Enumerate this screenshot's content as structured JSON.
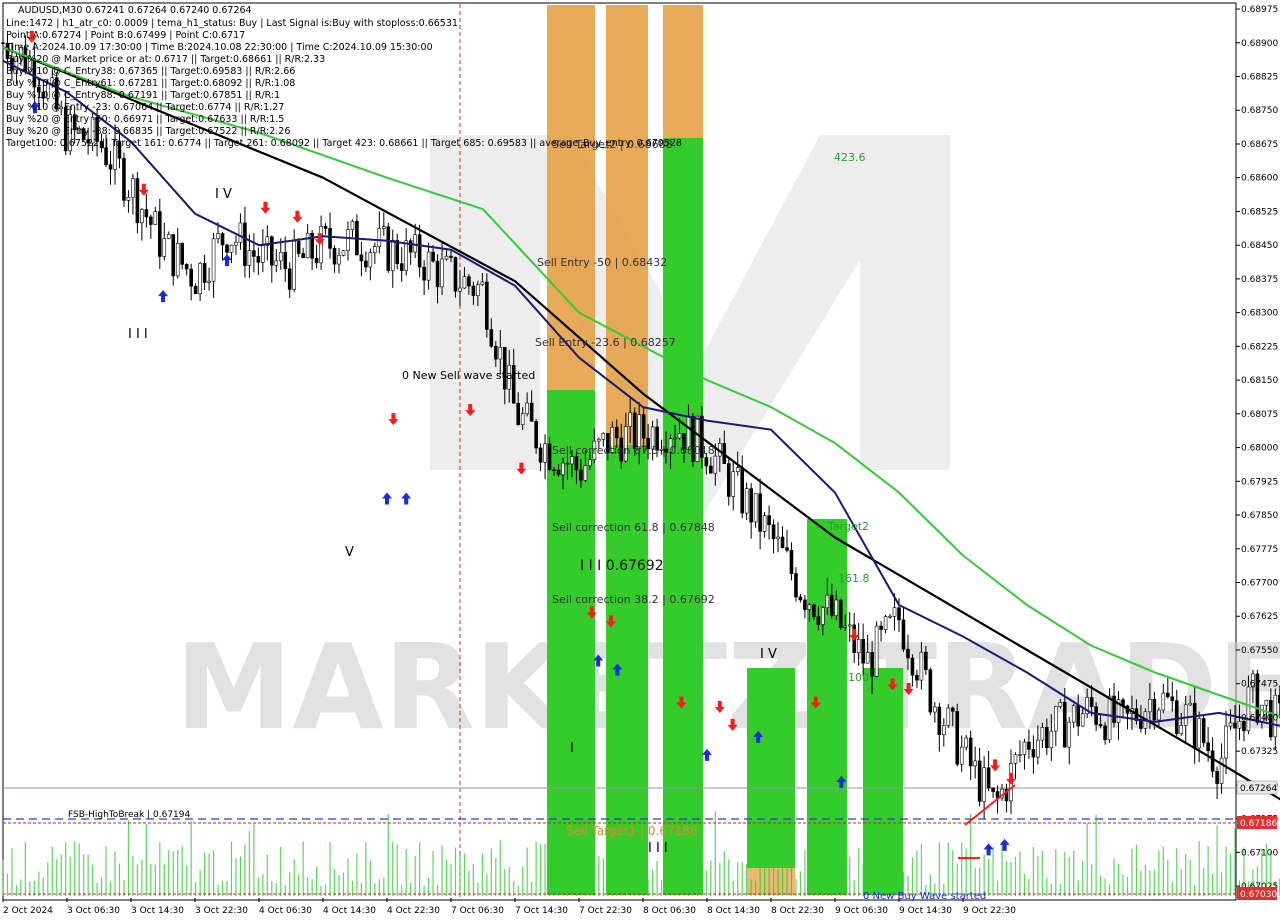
{
  "chart_title": "AUDUSD,M30  0.67241 0.67264 0.67240 0.67264",
  "info_lines": [
    "Line:1472 | h1_atr_c0: 0.0009 | tema_h1_status: Buy | Last Signal is:Buy with stoploss:0.66531",
    "Point A:0.67274 | Point B:0.67499 | Point C:0.6717",
    "Time A:2024.10.09 17:30:00 | Time B:2024.10.08 22:30:00 | Time C:2024.10.09 15:30:00",
    "Buy %20 @ Market price or at: 0.6717 || Target:0.68661 || R/R:2.33",
    "Buy %10 @ C_Entry38: 0.67365 || Target:0.69583 || R/R:2.66",
    "Buy %10 @ C_Entry61: 0.67281 || Target:0.68092 || R/R:1.08",
    "Buy %10 @ C_Entry88: 0.67191 || Target:0.67851 || R/R:1",
    "Buy %10 @ Entry -23: 0.67064 || Target:0.6774 || R/R:1.27",
    "Buy %20 @ Entry -50: 0.66971 || Target:0.67633 || R/R:1.5",
    "Buy %20 @ Entry -88: 0.66835 || Target:0.67522 || R/R:2.26",
    "Target100: 0.67522 || Target 161: 0.6774 || Target 261: 0.68092 || Target 423: 0.68661 || Target 685: 0.69583 || average_Buy_entry: 0.670528"
  ],
  "annotations": {
    "sell_target_top": "Sell Target2 | 0.68688",
    "sell_entry_50": "Sell Entry -50 | 0.68432",
    "sell_entry_23": "Sell Entry -23.6 | 0.68257",
    "sell_corr_87": "Sell correction 87.5 | 0.68018",
    "sell_corr_61": "Sell correction 61.8 | 0.67848",
    "sell_corr_38": "Sell correction 38.2 | 0.67692",
    "pivot_level": "I I I 0.67692",
    "sell_target1": "Sell Target1 | 0.67186",
    "fsb": "FSB-HighToBreak | 0.67194",
    "new_sell_wave": "0 New Sell wave started",
    "new_buy_wave": "0 New Buy Wave started",
    "fib_423": "423.6",
    "fib_261": "Target2",
    "fib_161": "161.8",
    "fib_100": "100",
    "wave_iv_left": "I V",
    "wave_iii_left": "I I I",
    "wave_v_left": "V",
    "wave_i": "I",
    "wave_iii_bottom": "I I I",
    "wave_iv_right": "I V"
  },
  "watermark": "MARKETZITRADE",
  "chart_data": {
    "type": "candlestick",
    "symbol": "AUDUSD",
    "timeframe": "M30",
    "ylim": [
      0.67003,
      0.68984
    ],
    "y_ticks": [
      "0.68975",
      "0.68900",
      "0.68825",
      "0.68750",
      "0.68675",
      "0.68600",
      "0.68525",
      "0.68450",
      "0.68375",
      "0.68300",
      "0.68225",
      "0.68150",
      "0.68075",
      "0.68000",
      "0.67925",
      "0.67850",
      "0.67775",
      "0.67700",
      "0.67625",
      "0.67550",
      "0.67475",
      "0.67400",
      "0.67325",
      "0.67250",
      "0.67175",
      "0.67100",
      "0.67025"
    ],
    "x_ticks": [
      "2 Oct 2024",
      "3 Oct 06:30",
      "3 Oct 14:30",
      "3 Oct 22:30",
      "4 Oct 06:30",
      "4 Oct 14:30",
      "4 Oct 22:30",
      "7 Oct 06:30",
      "7 Oct 14:30",
      "7 Oct 22:30",
      "8 Oct 06:30",
      "8 Oct 14:30",
      "8 Oct 22:30",
      "9 Oct 06:30",
      "9 Oct 14:30",
      "9 Oct 22:30"
    ],
    "current_price": "0.67264",
    "price_labels": [
      "0.67264",
      "0.67186",
      "0.67030"
    ],
    "close_path": [
      [
        0,
        0.689
      ],
      [
        0.5,
        0.6885
      ],
      [
        1,
        0.687
      ],
      [
        1.5,
        0.6868
      ],
      [
        2,
        0.6858
      ],
      [
        2.5,
        0.6845
      ],
      [
        3,
        0.6838
      ],
      [
        3.5,
        0.6848
      ],
      [
        4,
        0.6842
      ],
      [
        4.5,
        0.684
      ],
      [
        5,
        0.6845
      ],
      [
        5.5,
        0.6846
      ],
      [
        6,
        0.6844
      ],
      [
        6.5,
        0.6842
      ],
      [
        7,
        0.6838
      ],
      [
        7.5,
        0.6835
      ],
      [
        8,
        0.6808
      ],
      [
        8.5,
        0.68
      ],
      [
        9,
        0.6795
      ],
      [
        9.5,
        0.6802
      ],
      [
        10,
        0.6803
      ],
      [
        10.5,
        0.6805
      ],
      [
        11,
        0.68
      ],
      [
        11.5,
        0.679
      ],
      [
        12,
        0.678
      ],
      [
        12.5,
        0.6768
      ],
      [
        13,
        0.6762
      ],
      [
        13.5,
        0.6752
      ],
      [
        14,
        0.6762
      ],
      [
        14.5,
        0.6745
      ],
      [
        15,
        0.6732
      ],
      [
        15.5,
        0.672
      ],
      [
        16,
        0.6735
      ],
      [
        16.5,
        0.6738
      ],
      [
        17,
        0.6742
      ],
      [
        17.5,
        0.6738
      ],
      [
        18,
        0.6745
      ],
      [
        18.5,
        0.674
      ],
      [
        19,
        0.673
      ],
      [
        19.5,
        0.6745
      ],
      [
        20,
        0.6738
      ],
      [
        20.5,
        0.6732
      ],
      [
        21,
        0.6718
      ],
      [
        21.5,
        0.6714
      ],
      [
        22,
        0.6716
      ],
      [
        22.5,
        0.6726
      ]
    ],
    "series": [
      {
        "name": "slow-ma",
        "color": "#000000",
        "points": [
          [
            0,
            0.6889
          ],
          [
            5,
            0.686
          ],
          [
            8,
            0.6837
          ],
          [
            10,
            0.6812
          ],
          [
            13,
            0.678
          ],
          [
            16,
            0.6755
          ],
          [
            19,
            0.673
          ],
          [
            22.5,
            0.67
          ]
        ]
      },
      {
        "name": "fast-ma",
        "color": "#1a1a7a",
        "points": [
          [
            0,
            0.6886
          ],
          [
            1,
            0.6879
          ],
          [
            2,
            0.6868
          ],
          [
            3,
            0.6852
          ],
          [
            4,
            0.6845
          ],
          [
            5,
            0.6847
          ],
          [
            6,
            0.6846
          ],
          [
            7,
            0.6844
          ],
          [
            8,
            0.6836
          ],
          [
            9,
            0.682
          ],
          [
            10,
            0.6809
          ],
          [
            11,
            0.6806
          ],
          [
            12,
            0.6804
          ],
          [
            13,
            0.679
          ],
          [
            14,
            0.6765
          ],
          [
            15,
            0.6758
          ],
          [
            16,
            0.675
          ],
          [
            17,
            0.6741
          ],
          [
            18,
            0.6739
          ],
          [
            19,
            0.6741
          ],
          [
            20,
            0.6738
          ],
          [
            21,
            0.6727
          ],
          [
            22,
            0.672
          ],
          [
            22.5,
            0.6722
          ]
        ]
      },
      {
        "name": "mid-ma",
        "color": "#33cc33",
        "points": [
          [
            0,
            0.6889
          ],
          [
            2,
            0.6878
          ],
          [
            4,
            0.687
          ],
          [
            6,
            0.686
          ],
          [
            7.5,
            0.6853
          ],
          [
            9,
            0.683
          ],
          [
            11,
            0.6815
          ],
          [
            12,
            0.6809
          ],
          [
            13,
            0.6801
          ],
          [
            14,
            0.679
          ],
          [
            15,
            0.6776
          ],
          [
            16,
            0.6765
          ],
          [
            17,
            0.6756
          ],
          [
            18,
            0.675
          ],
          [
            19,
            0.6745
          ],
          [
            20,
            0.674
          ],
          [
            21,
            0.6735
          ],
          [
            22,
            0.6728
          ],
          [
            22.5,
            0.6726
          ]
        ]
      }
    ],
    "levels": [
      {
        "name": "fsb",
        "value": 0.67194
      },
      {
        "name": "sell-target1",
        "value": 0.67186
      },
      {
        "name": "bottom-level",
        "value": 0.6703
      },
      {
        "name": "current",
        "value": 0.67264
      }
    ]
  }
}
